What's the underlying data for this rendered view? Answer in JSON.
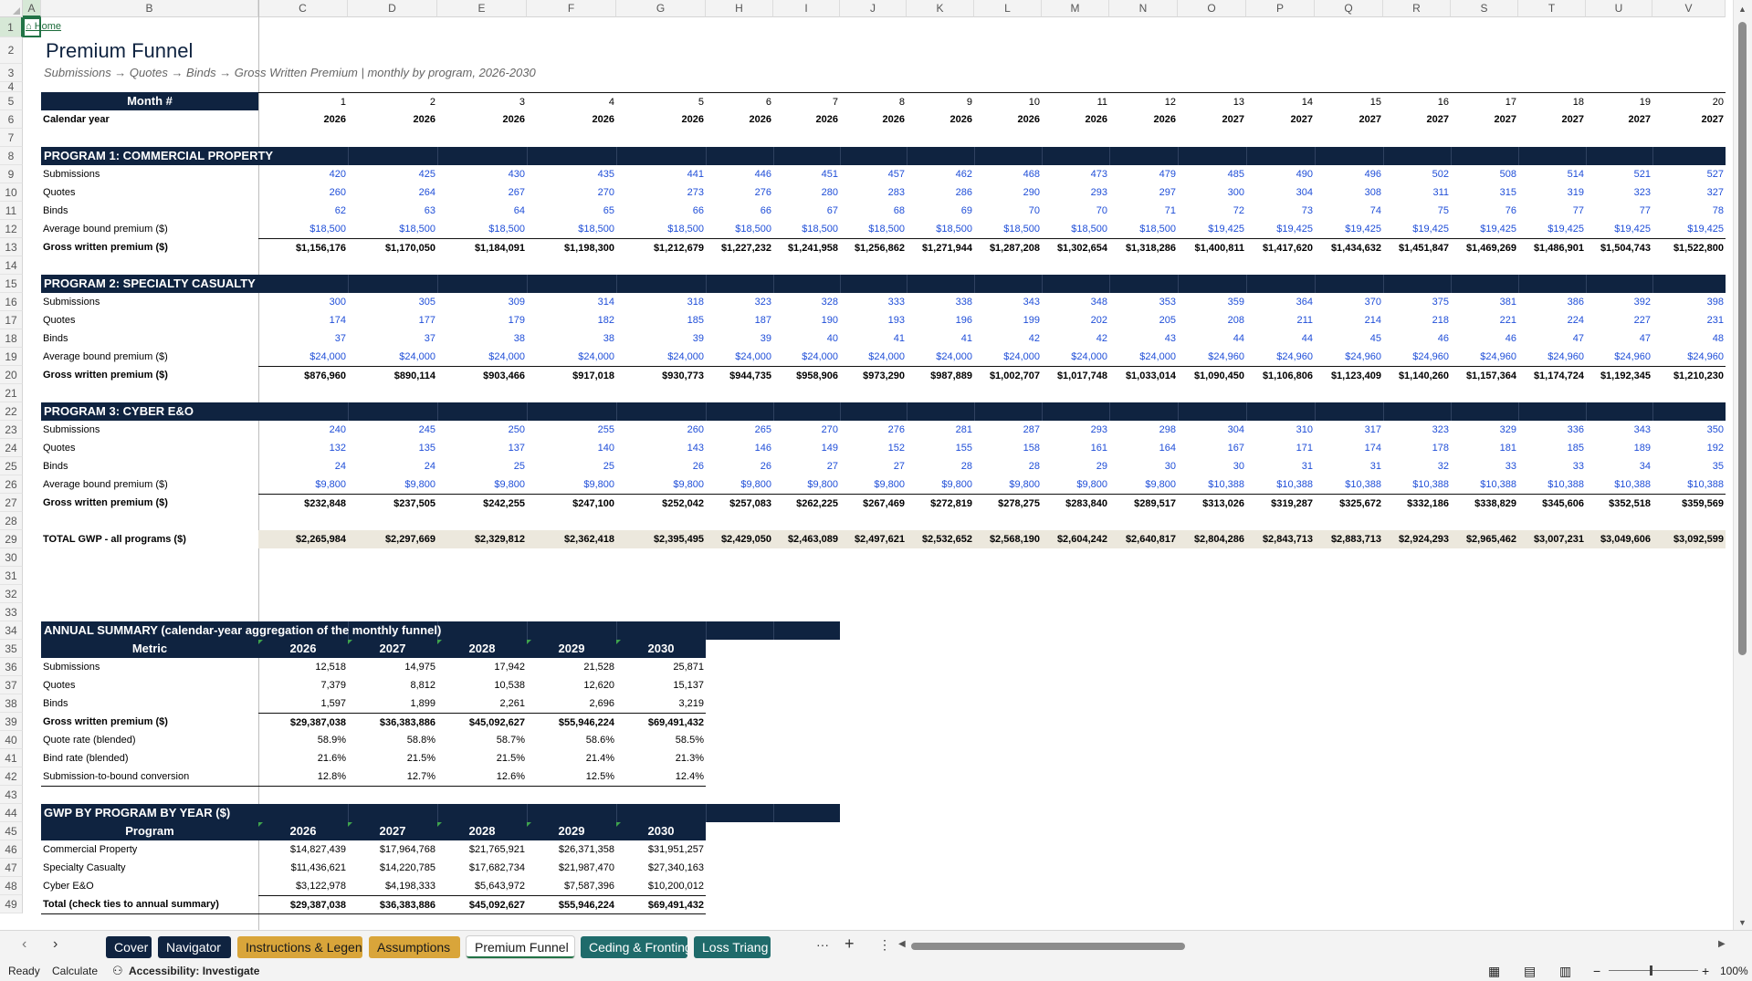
{
  "columns": [
    "A",
    "B",
    "C",
    "D",
    "E",
    "F",
    "G",
    "H",
    "I",
    "J",
    "K",
    "L",
    "M",
    "N",
    "O",
    "P",
    "Q",
    "R",
    "S",
    "T",
    "U",
    "V"
  ],
  "home_link": "⌂ Home",
  "title": "Premium Funnel",
  "subtitle": "Submissions → Quotes → Binds → Gross Written Premium | monthly by program, 2026-2030",
  "header_rows": {
    "month_label": "Month #",
    "months": [
      "1",
      "2",
      "3",
      "4",
      "5",
      "6",
      "7",
      "8",
      "9",
      "10",
      "11",
      "12",
      "13",
      "14",
      "15",
      "16",
      "17",
      "18",
      "19",
      "20"
    ],
    "year_label": "Calendar year",
    "years": [
      "2026",
      "2026",
      "2026",
      "2026",
      "2026",
      "2026",
      "2026",
      "2026",
      "2026",
      "2026",
      "2026",
      "2026",
      "2027",
      "2027",
      "2027",
      "2027",
      "2027",
      "2027",
      "2027",
      "2027"
    ]
  },
  "programs": [
    {
      "title": "PROGRAM 1: COMMERCIAL PROPERTY",
      "rows": [
        {
          "label": "Submissions",
          "style": "blue",
          "values": [
            "420",
            "425",
            "430",
            "435",
            "441",
            "446",
            "451",
            "457",
            "462",
            "468",
            "473",
            "479",
            "485",
            "490",
            "496",
            "502",
            "508",
            "514",
            "521",
            "527"
          ]
        },
        {
          "label": "Quotes",
          "style": "blue",
          "values": [
            "260",
            "264",
            "267",
            "270",
            "273",
            "276",
            "280",
            "283",
            "286",
            "290",
            "293",
            "297",
            "300",
            "304",
            "308",
            "311",
            "315",
            "319",
            "323",
            "327"
          ]
        },
        {
          "label": "Binds",
          "style": "blue",
          "values": [
            "62",
            "63",
            "64",
            "65",
            "66",
            "66",
            "67",
            "68",
            "69",
            "70",
            "70",
            "71",
            "72",
            "73",
            "74",
            "75",
            "76",
            "77",
            "77",
            "78"
          ]
        },
        {
          "label": "Average bound premium ($)",
          "style": "blue",
          "values": [
            "$18,500",
            "$18,500",
            "$18,500",
            "$18,500",
            "$18,500",
            "$18,500",
            "$18,500",
            "$18,500",
            "$18,500",
            "$18,500",
            "$18,500",
            "$18,500",
            "$19,425",
            "$19,425",
            "$19,425",
            "$19,425",
            "$19,425",
            "$19,425",
            "$19,425",
            "$19,425"
          ]
        },
        {
          "label": "Gross written premium ($)",
          "style": "bold",
          "values": [
            "$1,156,176",
            "$1,170,050",
            "$1,184,091",
            "$1,198,300",
            "$1,212,679",
            "$1,227,232",
            "$1,241,958",
            "$1,256,862",
            "$1,271,944",
            "$1,287,208",
            "$1,302,654",
            "$1,318,286",
            "$1,400,811",
            "$1,417,620",
            "$1,434,632",
            "$1,451,847",
            "$1,469,269",
            "$1,486,901",
            "$1,504,743",
            "$1,522,800"
          ]
        }
      ]
    },
    {
      "title": "PROGRAM 2: SPECIALTY CASUALTY",
      "rows": [
        {
          "label": "Submissions",
          "style": "blue",
          "values": [
            "300",
            "305",
            "309",
            "314",
            "318",
            "323",
            "328",
            "333",
            "338",
            "343",
            "348",
            "353",
            "359",
            "364",
            "370",
            "375",
            "381",
            "386",
            "392",
            "398"
          ]
        },
        {
          "label": "Quotes",
          "style": "blue",
          "values": [
            "174",
            "177",
            "179",
            "182",
            "185",
            "187",
            "190",
            "193",
            "196",
            "199",
            "202",
            "205",
            "208",
            "211",
            "214",
            "218",
            "221",
            "224",
            "227",
            "231"
          ]
        },
        {
          "label": "Binds",
          "style": "blue",
          "values": [
            "37",
            "37",
            "38",
            "38",
            "39",
            "39",
            "40",
            "41",
            "41",
            "42",
            "42",
            "43",
            "44",
            "44",
            "45",
            "46",
            "46",
            "47",
            "47",
            "48"
          ]
        },
        {
          "label": "Average bound premium ($)",
          "style": "blue",
          "values": [
            "$24,000",
            "$24,000",
            "$24,000",
            "$24,000",
            "$24,000",
            "$24,000",
            "$24,000",
            "$24,000",
            "$24,000",
            "$24,000",
            "$24,000",
            "$24,000",
            "$24,960",
            "$24,960",
            "$24,960",
            "$24,960",
            "$24,960",
            "$24,960",
            "$24,960",
            "$24,960"
          ]
        },
        {
          "label": "Gross written premium ($)",
          "style": "bold",
          "values": [
            "$876,960",
            "$890,114",
            "$903,466",
            "$917,018",
            "$930,773",
            "$944,735",
            "$958,906",
            "$973,290",
            "$987,889",
            "$1,002,707",
            "$1,017,748",
            "$1,033,014",
            "$1,090,450",
            "$1,106,806",
            "$1,123,409",
            "$1,140,260",
            "$1,157,364",
            "$1,174,724",
            "$1,192,345",
            "$1,210,230"
          ]
        }
      ]
    },
    {
      "title": "PROGRAM 3: CYBER E&O",
      "rows": [
        {
          "label": "Submissions",
          "style": "blue",
          "values": [
            "240",
            "245",
            "250",
            "255",
            "260",
            "265",
            "270",
            "276",
            "281",
            "287",
            "293",
            "298",
            "304",
            "310",
            "317",
            "323",
            "329",
            "336",
            "343",
            "350"
          ]
        },
        {
          "label": "Quotes",
          "style": "blue",
          "values": [
            "132",
            "135",
            "137",
            "140",
            "143",
            "146",
            "149",
            "152",
            "155",
            "158",
            "161",
            "164",
            "167",
            "171",
            "174",
            "178",
            "181",
            "185",
            "189",
            "192"
          ]
        },
        {
          "label": "Binds",
          "style": "blue",
          "values": [
            "24",
            "24",
            "25",
            "25",
            "26",
            "26",
            "27",
            "27",
            "28",
            "28",
            "29",
            "30",
            "30",
            "31",
            "31",
            "32",
            "33",
            "33",
            "34",
            "35"
          ]
        },
        {
          "label": "Average bound premium ($)",
          "style": "blue",
          "values": [
            "$9,800",
            "$9,800",
            "$9,800",
            "$9,800",
            "$9,800",
            "$9,800",
            "$9,800",
            "$9,800",
            "$9,800",
            "$9,800",
            "$9,800",
            "$9,800",
            "$10,388",
            "$10,388",
            "$10,388",
            "$10,388",
            "$10,388",
            "$10,388",
            "$10,388",
            "$10,388"
          ]
        },
        {
          "label": "Gross written premium ($)",
          "style": "bold",
          "values": [
            "$232,848",
            "$237,505",
            "$242,255",
            "$247,100",
            "$252,042",
            "$257,083",
            "$262,225",
            "$267,469",
            "$272,819",
            "$278,275",
            "$283,840",
            "$289,517",
            "$313,026",
            "$319,287",
            "$325,672",
            "$332,186",
            "$338,829",
            "$345,606",
            "$352,518",
            "$359,569"
          ]
        }
      ]
    }
  ],
  "total_row": {
    "label": "TOTAL GWP - all programs ($)",
    "values": [
      "$2,265,984",
      "$2,297,669",
      "$2,329,812",
      "$2,362,418",
      "$2,395,495",
      "$2,429,050",
      "$2,463,089",
      "$2,497,621",
      "$2,532,652",
      "$2,568,190",
      "$2,604,242",
      "$2,640,817",
      "$2,804,286",
      "$2,843,713",
      "$2,883,713",
      "$2,924,293",
      "$2,965,462",
      "$3,007,231",
      "$3,049,606",
      "$3,092,599"
    ]
  },
  "annual_summary": {
    "title": "ANNUAL SUMMARY (calendar-year aggregation of the monthly funnel)",
    "header": [
      "Metric",
      "2026",
      "2027",
      "2028",
      "2029",
      "2030"
    ],
    "rows": [
      {
        "label": "Submissions",
        "bold": false,
        "values": [
          "12,518",
          "14,975",
          "17,942",
          "21,528",
          "25,871"
        ]
      },
      {
        "label": "Quotes",
        "bold": false,
        "values": [
          "7,379",
          "8,812",
          "10,538",
          "12,620",
          "15,137"
        ]
      },
      {
        "label": "Binds",
        "bold": false,
        "values": [
          "1,597",
          "1,899",
          "2,261",
          "2,696",
          "3,219"
        ]
      },
      {
        "label": "Gross written premium ($)",
        "bold": true,
        "values": [
          "$29,387,038",
          "$36,383,886",
          "$45,092,627",
          "$55,946,224",
          "$69,491,432"
        ]
      },
      {
        "label": "Quote rate (blended)",
        "bold": false,
        "values": [
          "58.9%",
          "58.8%",
          "58.7%",
          "58.6%",
          "58.5%"
        ]
      },
      {
        "label": "Bind rate (blended)",
        "bold": false,
        "values": [
          "21.6%",
          "21.5%",
          "21.5%",
          "21.4%",
          "21.3%"
        ]
      },
      {
        "label": "Submission-to-bound conversion",
        "bold": false,
        "values": [
          "12.8%",
          "12.7%",
          "12.6%",
          "12.5%",
          "12.4%"
        ]
      }
    ]
  },
  "gwp_by_program": {
    "title": "GWP BY PROGRAM BY YEAR ($)",
    "header": [
      "Program",
      "2026",
      "2027",
      "2028",
      "2029",
      "2030"
    ],
    "rows": [
      {
        "label": "Commercial Property",
        "bold": false,
        "values": [
          "$14,827,439",
          "$17,964,768",
          "$21,765,921",
          "$26,371,358",
          "$31,951,257"
        ]
      },
      {
        "label": "Specialty Casualty",
        "bold": false,
        "values": [
          "$11,436,621",
          "$14,220,785",
          "$17,682,734",
          "$21,987,470",
          "$27,340,163"
        ]
      },
      {
        "label": "Cyber E&O",
        "bold": false,
        "values": [
          "$3,122,978",
          "$4,198,333",
          "$5,643,972",
          "$7,587,396",
          "$10,200,012"
        ]
      },
      {
        "label": "Total (check ties to annual summary)",
        "bold": true,
        "values": [
          "$29,387,038",
          "$36,383,886",
          "$45,092,627",
          "$55,946,224",
          "$69,491,432"
        ]
      }
    ]
  },
  "tabs": [
    {
      "label": "Cover",
      "bg": "#0f2340",
      "fg": "#ffffff"
    },
    {
      "label": "Navigator",
      "bg": "#0f2340",
      "fg": "#ffffff"
    },
    {
      "label": "Instructions & Legend",
      "bg": "#d9a53a",
      "fg": "#1a1a1a"
    },
    {
      "label": "Assumptions",
      "bg": "#d9a53a",
      "fg": "#1a1a1a"
    },
    {
      "label": "Premium Funnel",
      "bg": "#ffffff",
      "fg": "#1a1a1a",
      "active": true
    },
    {
      "label": "Ceding & Fronting",
      "bg": "#1f6b6b",
      "fg": "#ffffff"
    },
    {
      "label": "Loss Triang",
      "bg": "#1f6b6b",
      "fg": "#ffffff"
    }
  ],
  "tab_more": "···",
  "tab_add": "+",
  "status": {
    "ready": "Ready",
    "calculate": "Calculate",
    "accessibility": "Accessibility: Investigate",
    "zoom": "100%"
  }
}
